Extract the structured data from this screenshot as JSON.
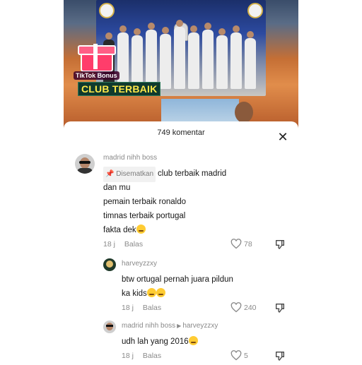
{
  "video": {
    "caption": "CLUB TERBAIK",
    "gift_label": "TikTok Bonus"
  },
  "comments_sheet": {
    "header": "749 komentar",
    "close_icon": "close-icon"
  },
  "comments": [
    {
      "username": "madrid nihh boss",
      "pinned_label": "Disematkan",
      "lines": [
        "club terbaik madrid",
        "dan mu",
        "pemain terbaik ronaldo",
        "timnas terbaik portugal",
        "fakta dek"
      ],
      "time": "18 j",
      "reply_label": "Balas",
      "likes": "78"
    },
    {
      "username": "harveyzzxy",
      "lines": [
        "btw ortugal pernah juara pildun",
        "ka kids"
      ],
      "time": "18 j",
      "reply_label": "Balas",
      "likes": "240"
    },
    {
      "username": "madrid nihh boss",
      "reply_to": "harveyzzxy",
      "lines": [
        "udh lah yang 2016"
      ],
      "time": "18 j",
      "reply_label": "Balas",
      "likes": "5"
    }
  ],
  "colors": {
    "caption_text": "#ffe94a",
    "muted_text": "#8a8a8a"
  }
}
